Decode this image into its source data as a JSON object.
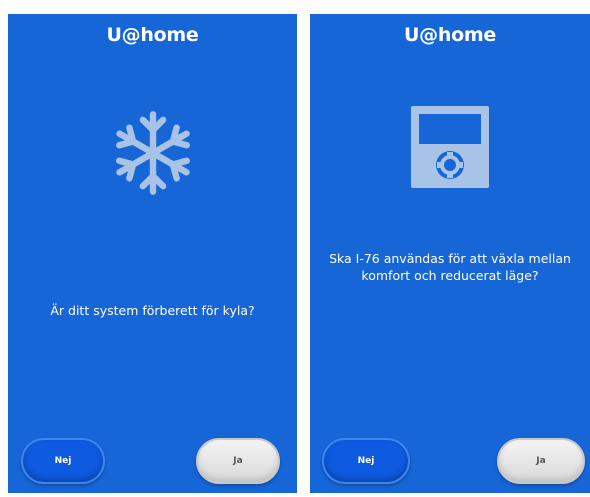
{
  "app": {
    "title": "U@home"
  },
  "screens": [
    {
      "icon": "snowflake-icon",
      "question": "Är ditt system förberett för kyla?",
      "no_label": "Nej",
      "yes_label": "Ja"
    },
    {
      "icon": "thermostat-device-icon",
      "question": "Ska I-76 användas för att växla mellan komfort och reducerat läge?",
      "no_label": "Nej",
      "yes_label": "Ja"
    }
  ],
  "colors": {
    "background": "#1666d8",
    "icon": "#a9c3e6",
    "no_button": "#0e5ae0",
    "yes_button": "#e8e8e8"
  }
}
